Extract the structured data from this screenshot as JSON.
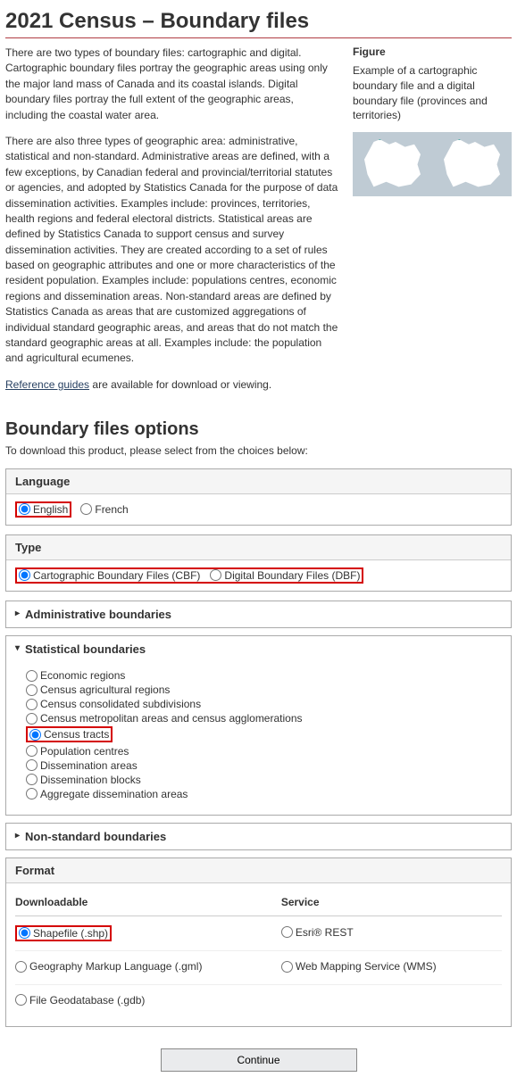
{
  "page_title": "2021 Census – Boundary files",
  "intro_p1": "There are two types of boundary files: cartographic and digital. Cartographic boundary files portray the geographic areas using only the major land mass of Canada and its coastal islands. Digital boundary files portray the full extent of the geographic areas, including the coastal water area.",
  "intro_p2": "There are also three types of geographic area: administrative, statistical and non-standard. Administrative areas are defined, with a few exceptions, by Canadian federal and provincial/territorial statutes or agencies, and adopted by Statistics Canada for the purpose of data dissemination activities. Examples include: provinces, territories, health regions and federal electoral districts. Statistical areas are defined by Statistics Canada to support census and survey dissemination activities. They are created according to a set of rules based on geographic attributes and one or more characteristics of the resident population. Examples include: populations centres, economic regions and dissemination areas. Non-standard areas are defined by Statistics Canada as areas that are customized aggregations of individual standard geographic areas, and areas that do not match the standard geographic areas at all. Examples include: the population and agricultural ecumenes.",
  "ref_link": "Reference guides",
  "ref_tail": " are available for download or viewing.",
  "figure": {
    "title": "Figure",
    "desc": "Example of a cartographic boundary file and a digital boundary file (provinces and territories)"
  },
  "options_heading": "Boundary files options",
  "options_instruction": "To download this product, please select from the choices below:",
  "language": {
    "legend": "Language",
    "english": "English",
    "french": "French"
  },
  "type": {
    "legend": "Type",
    "cbf": "Cartographic Boundary Files (CBF)",
    "dbf": "Digital Boundary Files (DBF)"
  },
  "admin": {
    "summary": "Administrative boundaries"
  },
  "stat": {
    "summary": "Statistical boundaries",
    "items": [
      "Economic regions",
      "Census agricultural regions",
      "Census consolidated subdivisions",
      "Census metropolitan areas and census agglomerations",
      "Census tracts",
      "Population centres",
      "Dissemination areas",
      "Dissemination blocks",
      "Aggregate dissemination areas"
    ]
  },
  "nonstd": {
    "summary": "Non-standard boundaries"
  },
  "format": {
    "legend": "Format",
    "col_download": "Downloadable",
    "col_service": "Service",
    "shp": "Shapefile (.shp)",
    "gml": "Geography Markup Language (.gml)",
    "gdb": "File Geodatabase (.gdb)",
    "esri": "Esri® REST",
    "wms": "Web Mapping Service (WMS)"
  },
  "continue": "Continue"
}
